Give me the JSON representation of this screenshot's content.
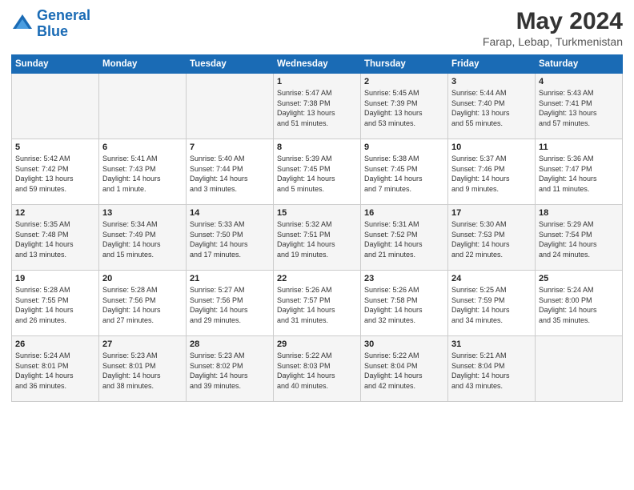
{
  "header": {
    "logo_line1": "General",
    "logo_line2": "Blue",
    "month": "May 2024",
    "location": "Farap, Lebap, Turkmenistan"
  },
  "days_of_week": [
    "Sunday",
    "Monday",
    "Tuesday",
    "Wednesday",
    "Thursday",
    "Friday",
    "Saturday"
  ],
  "weeks": [
    [
      {
        "num": "",
        "info": ""
      },
      {
        "num": "",
        "info": ""
      },
      {
        "num": "",
        "info": ""
      },
      {
        "num": "1",
        "info": "Sunrise: 5:47 AM\nSunset: 7:38 PM\nDaylight: 13 hours\nand 51 minutes."
      },
      {
        "num": "2",
        "info": "Sunrise: 5:45 AM\nSunset: 7:39 PM\nDaylight: 13 hours\nand 53 minutes."
      },
      {
        "num": "3",
        "info": "Sunrise: 5:44 AM\nSunset: 7:40 PM\nDaylight: 13 hours\nand 55 minutes."
      },
      {
        "num": "4",
        "info": "Sunrise: 5:43 AM\nSunset: 7:41 PM\nDaylight: 13 hours\nand 57 minutes."
      }
    ],
    [
      {
        "num": "5",
        "info": "Sunrise: 5:42 AM\nSunset: 7:42 PM\nDaylight: 13 hours\nand 59 minutes."
      },
      {
        "num": "6",
        "info": "Sunrise: 5:41 AM\nSunset: 7:43 PM\nDaylight: 14 hours\nand 1 minute."
      },
      {
        "num": "7",
        "info": "Sunrise: 5:40 AM\nSunset: 7:44 PM\nDaylight: 14 hours\nand 3 minutes."
      },
      {
        "num": "8",
        "info": "Sunrise: 5:39 AM\nSunset: 7:45 PM\nDaylight: 14 hours\nand 5 minutes."
      },
      {
        "num": "9",
        "info": "Sunrise: 5:38 AM\nSunset: 7:45 PM\nDaylight: 14 hours\nand 7 minutes."
      },
      {
        "num": "10",
        "info": "Sunrise: 5:37 AM\nSunset: 7:46 PM\nDaylight: 14 hours\nand 9 minutes."
      },
      {
        "num": "11",
        "info": "Sunrise: 5:36 AM\nSunset: 7:47 PM\nDaylight: 14 hours\nand 11 minutes."
      }
    ],
    [
      {
        "num": "12",
        "info": "Sunrise: 5:35 AM\nSunset: 7:48 PM\nDaylight: 14 hours\nand 13 minutes."
      },
      {
        "num": "13",
        "info": "Sunrise: 5:34 AM\nSunset: 7:49 PM\nDaylight: 14 hours\nand 15 minutes."
      },
      {
        "num": "14",
        "info": "Sunrise: 5:33 AM\nSunset: 7:50 PM\nDaylight: 14 hours\nand 17 minutes."
      },
      {
        "num": "15",
        "info": "Sunrise: 5:32 AM\nSunset: 7:51 PM\nDaylight: 14 hours\nand 19 minutes."
      },
      {
        "num": "16",
        "info": "Sunrise: 5:31 AM\nSunset: 7:52 PM\nDaylight: 14 hours\nand 21 minutes."
      },
      {
        "num": "17",
        "info": "Sunrise: 5:30 AM\nSunset: 7:53 PM\nDaylight: 14 hours\nand 22 minutes."
      },
      {
        "num": "18",
        "info": "Sunrise: 5:29 AM\nSunset: 7:54 PM\nDaylight: 14 hours\nand 24 minutes."
      }
    ],
    [
      {
        "num": "19",
        "info": "Sunrise: 5:28 AM\nSunset: 7:55 PM\nDaylight: 14 hours\nand 26 minutes."
      },
      {
        "num": "20",
        "info": "Sunrise: 5:28 AM\nSunset: 7:56 PM\nDaylight: 14 hours\nand 27 minutes."
      },
      {
        "num": "21",
        "info": "Sunrise: 5:27 AM\nSunset: 7:56 PM\nDaylight: 14 hours\nand 29 minutes."
      },
      {
        "num": "22",
        "info": "Sunrise: 5:26 AM\nSunset: 7:57 PM\nDaylight: 14 hours\nand 31 minutes."
      },
      {
        "num": "23",
        "info": "Sunrise: 5:26 AM\nSunset: 7:58 PM\nDaylight: 14 hours\nand 32 minutes."
      },
      {
        "num": "24",
        "info": "Sunrise: 5:25 AM\nSunset: 7:59 PM\nDaylight: 14 hours\nand 34 minutes."
      },
      {
        "num": "25",
        "info": "Sunrise: 5:24 AM\nSunset: 8:00 PM\nDaylight: 14 hours\nand 35 minutes."
      }
    ],
    [
      {
        "num": "26",
        "info": "Sunrise: 5:24 AM\nSunset: 8:01 PM\nDaylight: 14 hours\nand 36 minutes."
      },
      {
        "num": "27",
        "info": "Sunrise: 5:23 AM\nSunset: 8:01 PM\nDaylight: 14 hours\nand 38 minutes."
      },
      {
        "num": "28",
        "info": "Sunrise: 5:23 AM\nSunset: 8:02 PM\nDaylight: 14 hours\nand 39 minutes."
      },
      {
        "num": "29",
        "info": "Sunrise: 5:22 AM\nSunset: 8:03 PM\nDaylight: 14 hours\nand 40 minutes."
      },
      {
        "num": "30",
        "info": "Sunrise: 5:22 AM\nSunset: 8:04 PM\nDaylight: 14 hours\nand 42 minutes."
      },
      {
        "num": "31",
        "info": "Sunrise: 5:21 AM\nSunset: 8:04 PM\nDaylight: 14 hours\nand 43 minutes."
      },
      {
        "num": "",
        "info": ""
      }
    ]
  ]
}
